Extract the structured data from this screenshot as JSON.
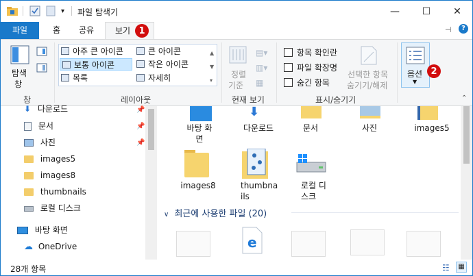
{
  "window": {
    "title": "파일 탐색기",
    "controls": {
      "minimize": "—",
      "maximize": "☐",
      "close": "✕"
    }
  },
  "tabs": {
    "file": "파일",
    "home": "홈",
    "share": "공유",
    "view": "보기",
    "view_badge": "1"
  },
  "ribbon": {
    "pane": {
      "label_line1": "탐색",
      "label_line2": "창",
      "group": "창"
    },
    "layout": {
      "group": "레이아웃",
      "items": [
        "아주 큰 아이콘",
        "큰 아이콘",
        "보통 아이콘",
        "작은 아이콘",
        "목록",
        "자세히"
      ],
      "selected": "보통 아이콘"
    },
    "current_view": {
      "group": "현재 보기",
      "sort_line1": "정렬",
      "sort_line2": "기준"
    },
    "show_hide": {
      "group": "표시/숨기기",
      "checkboxes": [
        "항목 확인란",
        "파일 확장명",
        "숨긴 항목"
      ],
      "hide_selected_line1": "선택한 항목",
      "hide_selected_line2": "숨기기/해제"
    },
    "options": {
      "label": "옵션",
      "badge": "2"
    }
  },
  "nav": {
    "items": [
      {
        "label": "다운로드",
        "pinned": true
      },
      {
        "label": "문서",
        "pinned": true
      },
      {
        "label": "사진",
        "pinned": true
      },
      {
        "label": "images5"
      },
      {
        "label": "images8"
      },
      {
        "label": "thumbnails"
      },
      {
        "label": "로컬 디스크"
      },
      {
        "label": "바탕 화면"
      },
      {
        "label": "OneDrive"
      }
    ]
  },
  "content": {
    "row1": [
      "바탕 화\n면",
      "다운로드",
      "문서",
      "사진",
      "images5"
    ],
    "row2": [
      "images8",
      "thumbna\nils",
      "로컬 디\n스크"
    ],
    "recent_header": "최근에 사용한 파일 (20)"
  },
  "status": {
    "count": "28개 항목"
  }
}
